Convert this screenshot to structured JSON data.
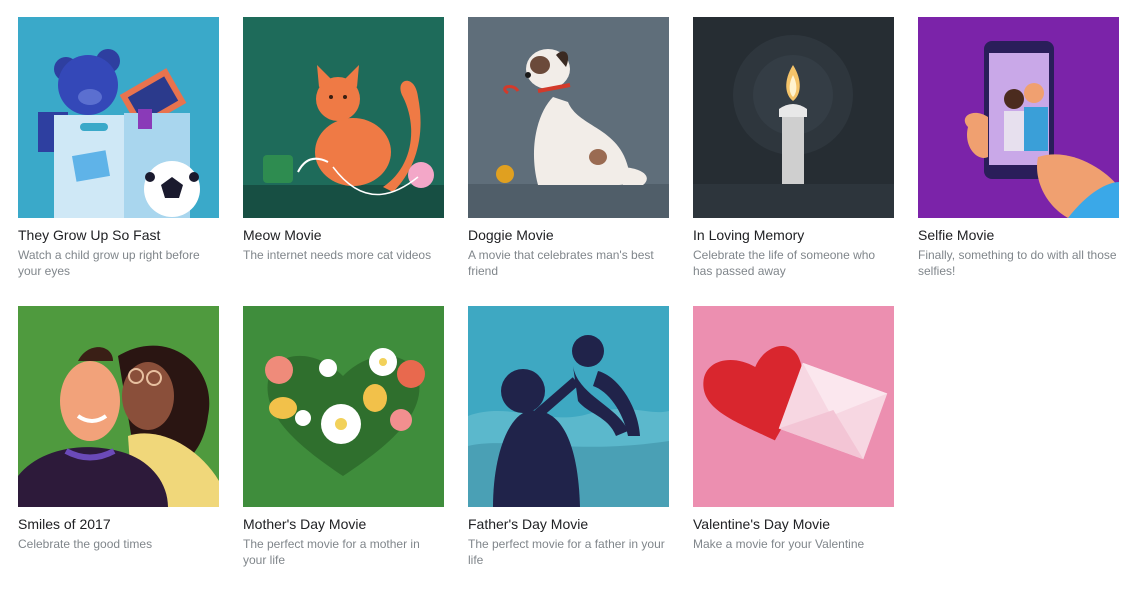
{
  "cards": [
    {
      "title": "They Grow Up So Fast",
      "description": "Watch a child grow up right before your eyes",
      "bg": "#3aa9c9"
    },
    {
      "title": "Meow Movie",
      "description": "The internet needs more cat videos",
      "bg": "#1e6b5a"
    },
    {
      "title": "Doggie Movie",
      "description": "A movie that celebrates man's best friend",
      "bg": "#5f6e7a"
    },
    {
      "title": "In Loving Memory",
      "description": "Celebrate the life of someone who has passed away",
      "bg": "#262d33"
    },
    {
      "title": "Selfie Movie",
      "description": "Finally, something to do with all those selfies!",
      "bg": "#7b23a9"
    },
    {
      "title": "Smiles of 2017",
      "description": "Celebrate the good times",
      "bg": "#4f9a3e"
    },
    {
      "title": "Mother's Day Movie",
      "description": "The perfect movie for a mother in your life",
      "bg": "#3f8d3c"
    },
    {
      "title": "Father's Day Movie",
      "description": "The perfect movie for a father in your life",
      "bg": "#3ea8c2"
    },
    {
      "title": "Valentine's Day Movie",
      "description": "Make a movie for your Valentine",
      "bg": "#ec8fb0"
    }
  ]
}
